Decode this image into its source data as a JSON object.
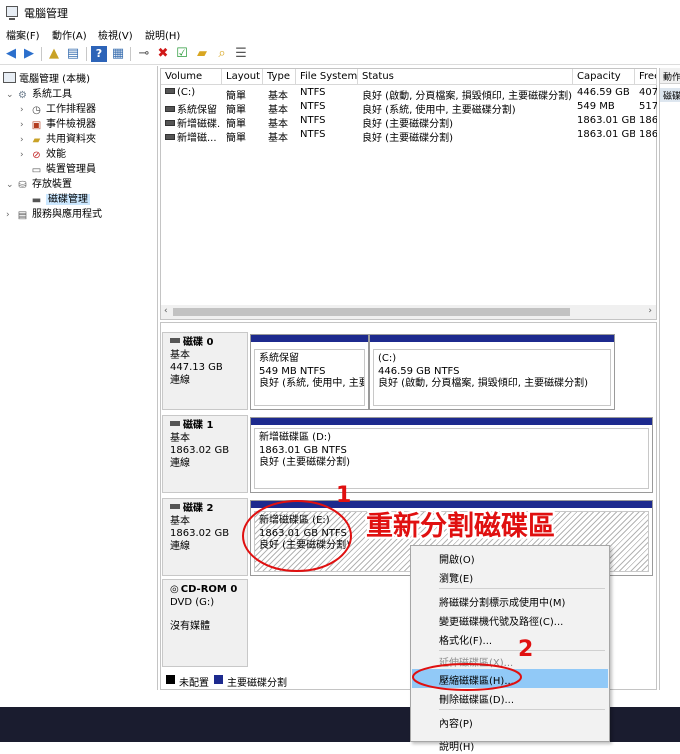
{
  "window": {
    "title": "電腦管理"
  },
  "menu": [
    "檔案(F)",
    "動作(A)",
    "檢視(V)",
    "說明(H)"
  ],
  "toolbar": {
    "icons": [
      "back-arrow-icon",
      "forward-arrow-icon",
      "up-folder-icon",
      "console-tree-icon",
      "help-icon",
      "properties-icon",
      "connect-icon",
      "delete-icon",
      "check-icon",
      "open-folder-icon",
      "search-folder-icon",
      "list-view-icon"
    ]
  },
  "tree": {
    "root": "電腦管理 (本機)",
    "system_tools": "系統工具",
    "task_scheduler": "工作排程器",
    "event_viewer": "事件檢視器",
    "shared_folders": "共用資料夾",
    "performance": "效能",
    "device_manager": "裝置管理員",
    "storage": "存放裝置",
    "disk_management": "磁碟管理",
    "services_apps": "服務與應用程式"
  },
  "volume_list": {
    "columns": [
      "Volume",
      "Layout",
      "Type",
      "File System",
      "Status",
      "Capacity",
      "Free"
    ],
    "rows": [
      {
        "volume": "(C:)",
        "layout": "簡單",
        "type": "基本",
        "fs": "NTFS",
        "status": "良好 (啟動, 分頁檔案, 損毀傾印, 主要磁碟分割)",
        "capacity": "446.59 GB",
        "free": "407"
      },
      {
        "volume": "系統保留",
        "layout": "簡單",
        "type": "基本",
        "fs": "NTFS",
        "status": "良好 (系統, 使用中, 主要磁碟分割)",
        "capacity": "549 MB",
        "free": "517"
      },
      {
        "volume": "新增磁碟...",
        "layout": "簡單",
        "type": "基本",
        "fs": "NTFS",
        "status": "良好 (主要磁碟分割)",
        "capacity": "1863.01 GB",
        "free": "186"
      },
      {
        "volume": "新增磁...",
        "layout": "簡單",
        "type": "基本",
        "fs": "NTFS",
        "status": "良好 (主要磁碟分割)",
        "capacity": "1863.01 GB",
        "free": "186"
      }
    ]
  },
  "actions": {
    "header": "動作",
    "item": "磁碟"
  },
  "disks": [
    {
      "name": "磁碟 0",
      "type": "基本",
      "size": "447.13 GB",
      "status": "連線"
    },
    {
      "name": "磁碟 1",
      "type": "基本",
      "size": "1863.02 GB",
      "status": "連線"
    },
    {
      "name": "磁碟 2",
      "type": "基本",
      "size": "1863.02 GB",
      "status": "連線"
    },
    {
      "name": "CD-ROM 0",
      "type": "DVD (G:)",
      "size": "",
      "status": "沒有媒體"
    }
  ],
  "partitions": {
    "d0_sys": {
      "name": "系統保留",
      "size": "549 MB NTFS",
      "status": "良好 (系統, 使用中, 主要"
    },
    "d0_c": {
      "name": "(C:)",
      "size": "446.59 GB NTFS",
      "status": "良好 (啟動, 分頁檔案, 損毀傾印, 主要磁碟分割)"
    },
    "d1_d": {
      "name": "新增磁碟區  (D:)",
      "size": "1863.01 GB NTFS",
      "status": "良好 (主要磁碟分割)"
    },
    "d2_e": {
      "name": "新增磁碟區  (E:)",
      "size": "1863.01 GB NTFS",
      "status": "良好 (主要磁碟分割)"
    }
  },
  "legend": {
    "unallocated": "未配置",
    "primary": "主要磁碟分割"
  },
  "context_menu": [
    {
      "label": "開啟(O)",
      "disabled": false
    },
    {
      "label": "瀏覽(E)",
      "disabled": false
    },
    {
      "label": "將磁碟分割標示成使用中(M)",
      "disabled": false
    },
    {
      "label": "變更磁碟機代號及路徑(C)...",
      "disabled": false
    },
    {
      "label": "格式化(F)...",
      "disabled": false
    },
    {
      "label": "延伸磁碟區(X)...",
      "disabled": true
    },
    {
      "label": "壓縮磁碟區(H)...",
      "disabled": false,
      "highlighted": true
    },
    {
      "label": "刪除磁碟區(D)...",
      "disabled": false
    },
    {
      "label": "內容(P)",
      "disabled": false
    },
    {
      "label": "說明(H)",
      "disabled": false
    }
  ],
  "annotations": {
    "step1": "1",
    "step2": "2",
    "callout": "重新分割磁碟區"
  },
  "colors": {
    "primary_partition_bar": "#1d2a8e",
    "highlight": "#91c9f7",
    "annotation": "#e01010",
    "taskbar": "#1a1c2f"
  }
}
